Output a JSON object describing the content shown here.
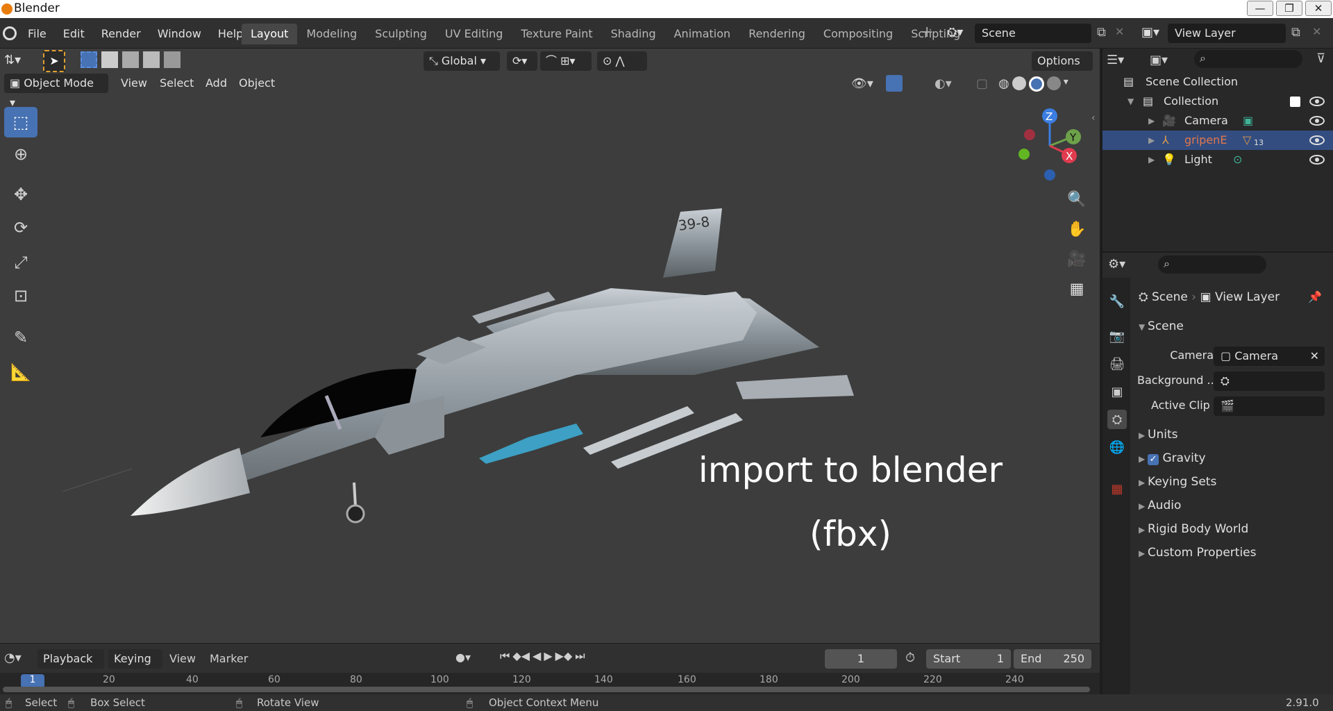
{
  "window": {
    "title": "Blender",
    "minimize": "—",
    "maximize": "❐",
    "close": "✕"
  },
  "menu": [
    "File",
    "Edit",
    "Render",
    "Window",
    "Help"
  ],
  "workspaces": [
    "Layout",
    "Modeling",
    "Sculpting",
    "UV Editing",
    "Texture Paint",
    "Shading",
    "Animation",
    "Rendering",
    "Compositing",
    "Scripting"
  ],
  "active_workspace": "Layout",
  "scene_selector": "Scene",
  "view_layer_selector": "View Layer",
  "toolbar": {
    "orientation": "Global",
    "options": "Options"
  },
  "viewport_header": {
    "mode": "Object Mode",
    "items": [
      "View",
      "Select",
      "Add",
      "Object"
    ]
  },
  "overlay_text": {
    "line1": "import to blender",
    "line2": "(fbx)"
  },
  "aircraft": {
    "tail_number": "39-8"
  },
  "gizmo": {
    "z": "Z",
    "y": "Y",
    "x": "X"
  },
  "outliner": {
    "root": "Scene Collection",
    "collection": "Collection",
    "items": [
      {
        "name": "Camera",
        "color": "#e0e0e0"
      },
      {
        "name": "gripenE",
        "color": "#e0774b",
        "badge": "13"
      },
      {
        "name": "Light",
        "color": "#e0e0e0"
      }
    ]
  },
  "properties": {
    "breadcrumb_scene": "Scene",
    "breadcrumb_layer": "View Layer",
    "panel": "Scene",
    "camera_label": "Camera",
    "camera_value": "Camera",
    "background_label": "Background ...",
    "active_clip_label": "Active Clip",
    "sections": [
      "Units",
      "Gravity",
      "Keying Sets",
      "Audio",
      "Rigid Body World",
      "Custom Properties"
    ],
    "gravity_checked": true
  },
  "timeline": {
    "menus": [
      "Playback",
      "Keying",
      "View",
      "Marker"
    ],
    "current_frame": "1",
    "start_label": "Start",
    "start": "1",
    "end_label": "End",
    "end": "250",
    "ticks": [
      "1",
      "20",
      "40",
      "60",
      "80",
      "100",
      "120",
      "140",
      "160",
      "180",
      "200",
      "220",
      "240"
    ]
  },
  "statusbar": {
    "select": "Select",
    "box_select": "Box Select",
    "rotate": "Rotate View",
    "context": "Object Context Menu",
    "version": "2.91.0"
  },
  "colors": {
    "accent": "#4772b3",
    "selected_object": "#e0774b",
    "viewport_bg": "#3d3d3d"
  }
}
